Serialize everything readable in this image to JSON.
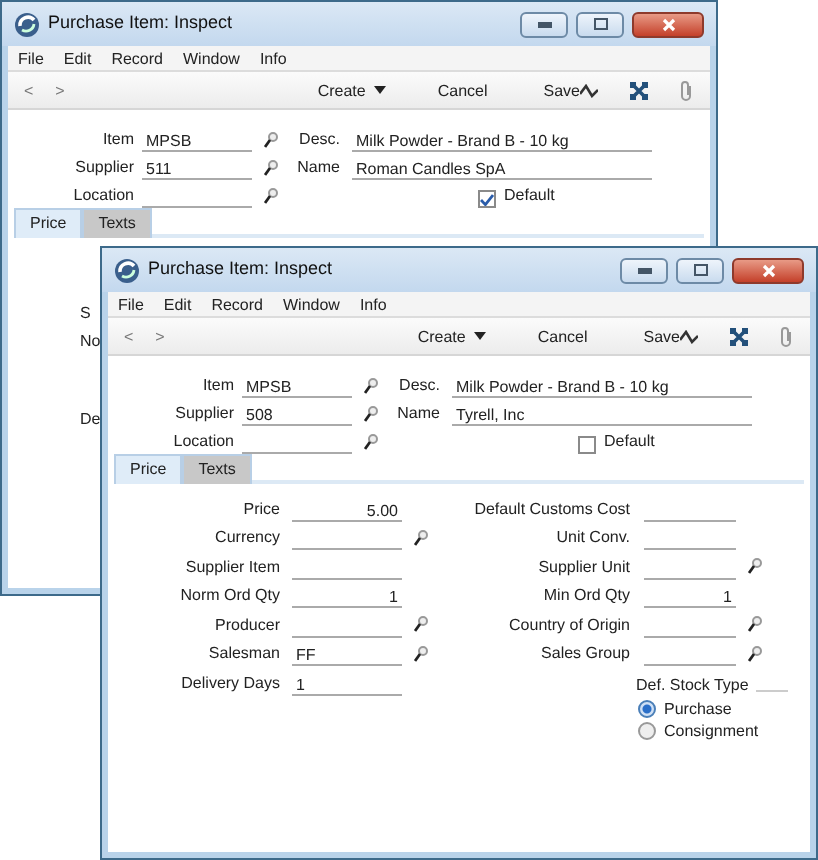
{
  "windows": [
    {
      "title": "Purchase Item: Inspect",
      "menu": [
        "File",
        "Edit",
        "Record",
        "Window",
        "Info"
      ],
      "nav": [
        "<",
        ">"
      ],
      "actions": [
        "Create",
        "Cancel",
        "Save"
      ],
      "header": {
        "left": [
          {
            "label": "Item",
            "value": "MPSB",
            "lookup": true
          },
          {
            "label": "Supplier",
            "value": "511",
            "lookup": true
          },
          {
            "label": "Location",
            "lookup": true
          }
        ],
        "right": [
          {
            "label": "Desc.",
            "value": "Milk Powder - Brand B - 10 kg"
          },
          {
            "label": "Name",
            "value": "Roman Candles SpA"
          }
        ],
        "default_checkbox": {
          "label": "Default",
          "checked": true
        }
      },
      "tabs": [
        {
          "label": "Price",
          "selected": true
        },
        {
          "label": "Texts",
          "selected": false
        }
      ],
      "cut_labels": [
        "S",
        "No",
        "De"
      ]
    },
    {
      "title": "Purchase Item: Inspect",
      "menu": [
        "File",
        "Edit",
        "Record",
        "Window",
        "Info"
      ],
      "nav": [
        "<",
        ">"
      ],
      "actions": [
        "Create",
        "Cancel",
        "Save"
      ],
      "header": {
        "left": [
          {
            "label": "Item",
            "value": "MPSB",
            "lookup": true
          },
          {
            "label": "Supplier",
            "value": "508",
            "lookup": true
          },
          {
            "label": "Location",
            "lookup": true
          }
        ],
        "right": [
          {
            "label": "Desc.",
            "value": "Milk Powder - Brand B - 10 kg"
          },
          {
            "label": "Name",
            "value": "Tyrell, Inc"
          }
        ],
        "default_checkbox": {
          "label": "Default",
          "checked": false
        }
      },
      "tabs": [
        {
          "label": "Price",
          "selected": true
        },
        {
          "label": "Texts",
          "selected": false
        }
      ],
      "price": {
        "left": [
          {
            "label": "Price",
            "value": "5.00",
            "kind": "number",
            "lookup": false
          },
          {
            "label": "Currency",
            "kind": "text",
            "lookup": true
          },
          {
            "label": "Supplier Item",
            "kind": "text",
            "lookup": false
          },
          {
            "label": "Norm Ord Qty",
            "value": "1",
            "kind": "number",
            "lookup": false
          },
          {
            "label": "Producer",
            "kind": "text",
            "lookup": true
          },
          {
            "label": "Salesman",
            "value": "FF",
            "kind": "text",
            "lookup": true
          },
          {
            "label": "Delivery Days",
            "value": "1",
            "kind": "text",
            "lookup": false
          }
        ],
        "right": [
          {
            "label": "Default Customs Cost",
            "kind": "text",
            "lookup": false
          },
          {
            "label": "Unit Conv.",
            "kind": "text",
            "lookup": false
          },
          {
            "label": "Supplier Unit",
            "kind": "text",
            "lookup": true
          },
          {
            "label": "Min Ord Qty",
            "value": "1",
            "kind": "number",
            "lookup": false
          },
          {
            "label": "Country of Origin",
            "kind": "text",
            "lookup": true
          },
          {
            "label": "Sales Group",
            "kind": "text",
            "lookup": true
          }
        ],
        "stock_type": {
          "label": "Def. Stock Type",
          "options": [
            {
              "label": "Purchase",
              "selected": true
            },
            {
              "label": "Consignment",
              "selected": false
            }
          ]
        }
      }
    }
  ]
}
